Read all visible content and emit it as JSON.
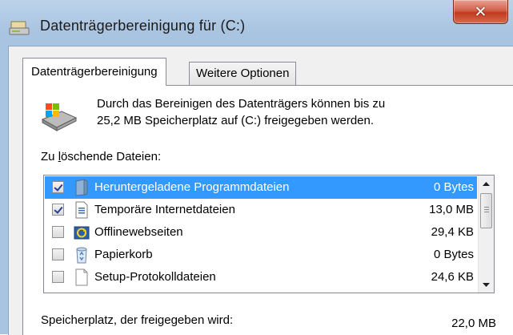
{
  "window": {
    "title": "Datenträgerbereinigung für  (C:)"
  },
  "tabs": [
    {
      "label": "Datenträgerbereinigung",
      "active": true
    },
    {
      "label": "Weitere Optionen",
      "active": false
    }
  ],
  "description": {
    "line1": "Durch das Bereinigen des Datenträgers können bis zu",
    "line2": "25,2 MB Speicherplatz auf  (C:) freigegeben werden."
  },
  "files_label_prefix": "Zu ",
  "files_label_access": "l",
  "files_label_rest": "öschende Dateien:",
  "file_list": [
    {
      "name": "Heruntergeladene Programmdateien",
      "size": "0 Bytes",
      "checked": true,
      "selected": true,
      "icon": "folder-icon"
    },
    {
      "name": "Temporäre Internetdateien",
      "size": "13,0 MB",
      "checked": true,
      "selected": false,
      "icon": "document-icon"
    },
    {
      "name": "Offlinewebseiten",
      "size": "29,4 KB",
      "checked": false,
      "selected": false,
      "icon": "offline-sync-icon"
    },
    {
      "name": "Papierkorb",
      "size": "0 Bytes",
      "checked": false,
      "selected": false,
      "icon": "recycle-bin-icon"
    },
    {
      "name": "Setup-Protokolldateien",
      "size": "24,6 KB",
      "checked": false,
      "selected": false,
      "icon": "blank-file-icon"
    }
  ],
  "space_freed": {
    "label": "Speicherplatz, der freigegeben wird:",
    "value": "22,0 MB"
  },
  "colors": {
    "selection": "#3399ff",
    "close_button": "#c8452b"
  }
}
